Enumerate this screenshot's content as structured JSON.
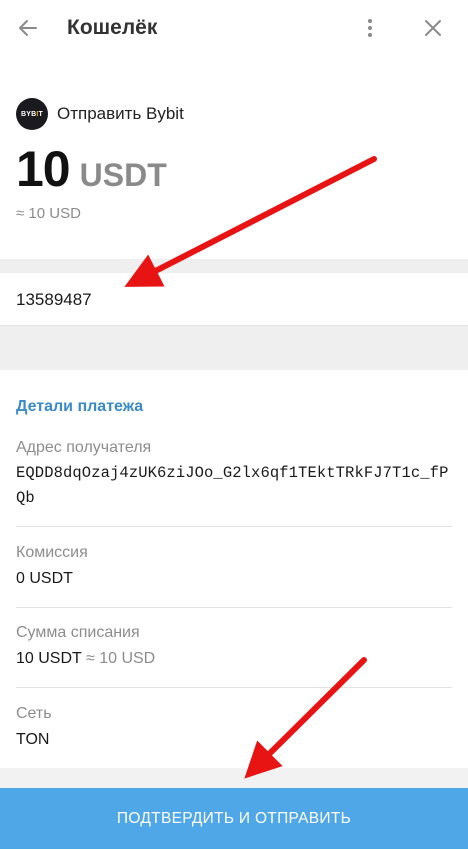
{
  "header": {
    "title": "Кошелёк",
    "back_icon": "arrow-left-icon",
    "more_icon": "more-vertical-icon",
    "close_icon": "close-icon"
  },
  "send": {
    "logo_text_main": "BYB",
    "logo_text_accent": "I",
    "logo_text_end": "T",
    "label": "Отправить Bybit",
    "amount": "10",
    "currency": "USDT",
    "approx": "≈ 10 USD"
  },
  "comment": {
    "value": "13589487"
  },
  "details": {
    "title": "Детали платежа",
    "address_label": "Адрес получателя",
    "address_value": "EQDD8dqOzaj4zUK6ziJOo_G2lx6qf1TEktTRkFJ7T1c_fPQb",
    "fee_label": "Комиссия",
    "fee_value": "0 USDT",
    "total_label": "Сумма списания",
    "total_value": "10 USDT",
    "total_approx": "≈ 10 USD",
    "network_label": "Сеть",
    "network_value": "TON"
  },
  "confirm": {
    "label": "ПОДТВЕРДИТЬ И ОТПРАВИТЬ"
  },
  "colors": {
    "accent": "#3a8ac8",
    "button": "#50a7e7",
    "annotation_arrow": "#e81414"
  }
}
